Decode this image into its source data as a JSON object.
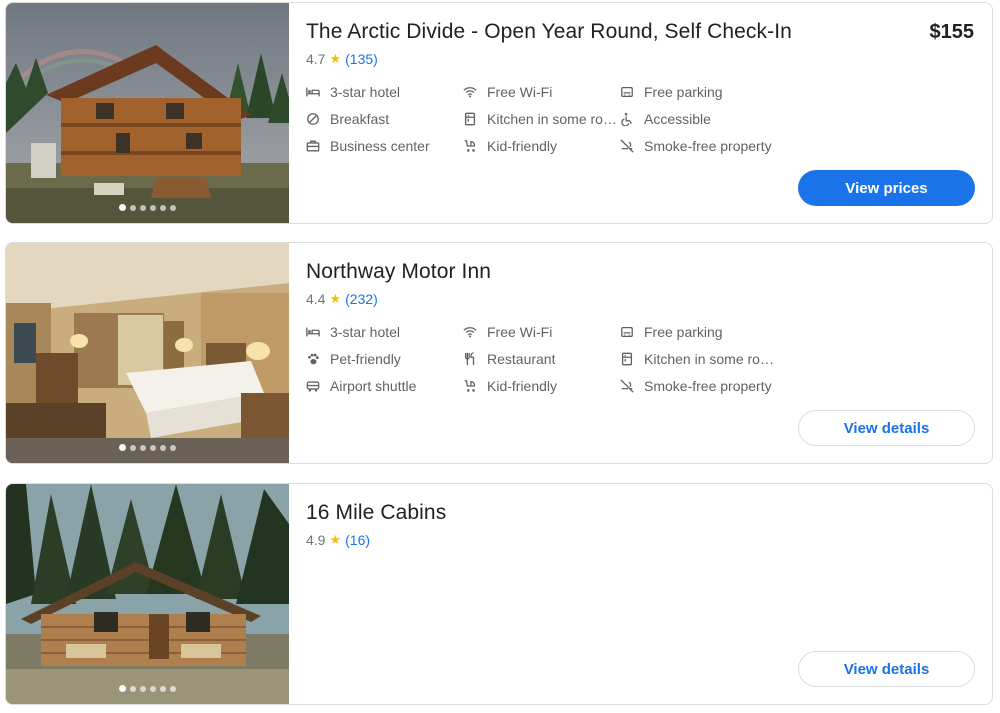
{
  "colors": {
    "accent": "#1a73e8",
    "star": "#fbbc04",
    "border": "#dadce0"
  },
  "hotels": [
    {
      "name": "The Arctic Divide - Open Year Round, Self Check-In",
      "price": "$155",
      "rating": "4.7",
      "reviews": "(135)",
      "button": "View prices",
      "amenities": [
        {
          "icon": "hotel-icon",
          "label": "3-star hotel"
        },
        {
          "icon": "wifi-icon",
          "label": "Free Wi-Fi"
        },
        {
          "icon": "parking-icon",
          "label": "Free parking"
        },
        {
          "icon": "no-icon",
          "label": "Breakfast"
        },
        {
          "icon": "kitchen-icon",
          "label": "Kitchen in some roo…"
        },
        {
          "icon": "accessible-icon",
          "label": "Accessible"
        },
        {
          "icon": "briefcase-icon",
          "label": "Business center"
        },
        {
          "icon": "stroller-icon",
          "label": "Kid-friendly"
        },
        {
          "icon": "no-smoking-icon",
          "label": "Smoke-free property"
        }
      ]
    },
    {
      "name": "Northway Motor Inn",
      "rating": "4.4",
      "reviews": "(232)",
      "button": "View details",
      "amenities": [
        {
          "icon": "hotel-icon",
          "label": "3-star hotel"
        },
        {
          "icon": "wifi-icon",
          "label": "Free Wi-Fi"
        },
        {
          "icon": "parking-icon",
          "label": "Free parking"
        },
        {
          "icon": "paw-icon",
          "label": "Pet-friendly"
        },
        {
          "icon": "restaurant-icon",
          "label": "Restaurant"
        },
        {
          "icon": "kitchen-icon",
          "label": "Kitchen in some roo…"
        },
        {
          "icon": "shuttle-icon",
          "label": "Airport shuttle"
        },
        {
          "icon": "stroller-icon",
          "label": "Kid-friendly"
        },
        {
          "icon": "no-smoking-icon",
          "label": "Smoke-free property"
        }
      ]
    },
    {
      "name": "16 Mile Cabins",
      "rating": "4.9",
      "reviews": "(16)",
      "button": "View details",
      "amenities": []
    }
  ]
}
